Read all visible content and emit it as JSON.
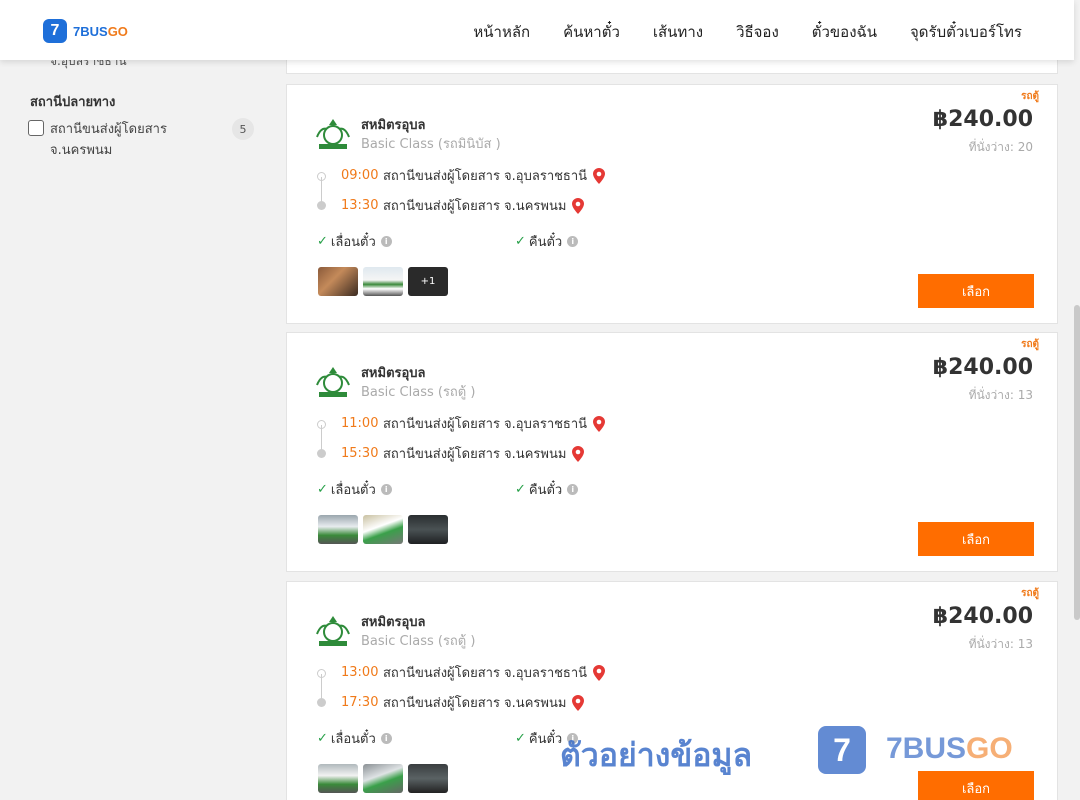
{
  "header": {
    "logo_num": "7",
    "logo_text_a": "7BUS",
    "logo_text_b": "GO",
    "nav": [
      "หน้าหลัก",
      "ค้นหาตั๋ว",
      "เส้นทาง",
      "วิธีจอง",
      "ตั๋วของฉัน",
      "จุดรับตั๋วเบอร์โทร"
    ]
  },
  "sidebar": {
    "previous_item": "จ.อุบลราชธานี",
    "section_title": "สถานีปลายทาง",
    "filters": [
      {
        "label": "สถานีขนส่งผู้โดยสาร จ.นครพนม",
        "count": "5"
      }
    ]
  },
  "cards": [
    {
      "type_badge": "รถตู้",
      "operator": "สหมิตรอุบล",
      "class": "Basic Class (รถมินิบัส )",
      "price": "฿240.00",
      "seats": "ที่นั่งว่าง: 20",
      "depart_time": "09:00",
      "depart_station": "สถานีขนส่งผู้โดยสาร จ.อุบลราชธานี",
      "arrive_time": "13:30",
      "arrive_station": "สถานีขนส่งผู้โดยสาร จ.นครพนม",
      "feature_1": "เลื่อนตั๋ว",
      "feature_2": "คืนตั๋ว",
      "more_photos": "+1",
      "button": "เลือก"
    },
    {
      "type_badge": "รถตู้",
      "operator": "สหมิตรอุบล",
      "class": "Basic Class (รถตู้ )",
      "price": "฿240.00",
      "seats": "ที่นั่งว่าง: 13",
      "depart_time": "11:00",
      "depart_station": "สถานีขนส่งผู้โดยสาร จ.อุบลราชธานี",
      "arrive_time": "15:30",
      "arrive_station": "สถานีขนส่งผู้โดยสาร จ.นครพนม",
      "feature_1": "เลื่อนตั๋ว",
      "feature_2": "คืนตั๋ว",
      "button": "เลือก"
    },
    {
      "type_badge": "รถตู้",
      "operator": "สหมิตรอุบล",
      "class": "Basic Class (รถตู้ )",
      "price": "฿240.00",
      "seats": "ที่นั่งว่าง: 13",
      "depart_time": "13:00",
      "depart_station": "สถานีขนส่งผู้โดยสาร จ.อุบลราชธานี",
      "arrive_time": "17:30",
      "arrive_station": "สถานีขนส่งผู้โดยสาร จ.นครพนม",
      "feature_1": "เลื่อนตั๋ว",
      "feature_2": "คืนตั๋ว",
      "button": "เลือก"
    }
  ],
  "watermark": {
    "text": "ตัวอย่างข้อมูล",
    "badge": "7",
    "brand_a": "7BUS",
    "brand_b": "GO"
  },
  "colors": {
    "accent": "#ff6d00",
    "time": "#f07a1a",
    "check": "#27a049",
    "pin": "#e53935",
    "brand_blue": "#1e6fd9"
  },
  "icons": [
    "map-pin-icon",
    "check-icon",
    "info-icon",
    "operator-logo",
    "checkbox-icon"
  ]
}
